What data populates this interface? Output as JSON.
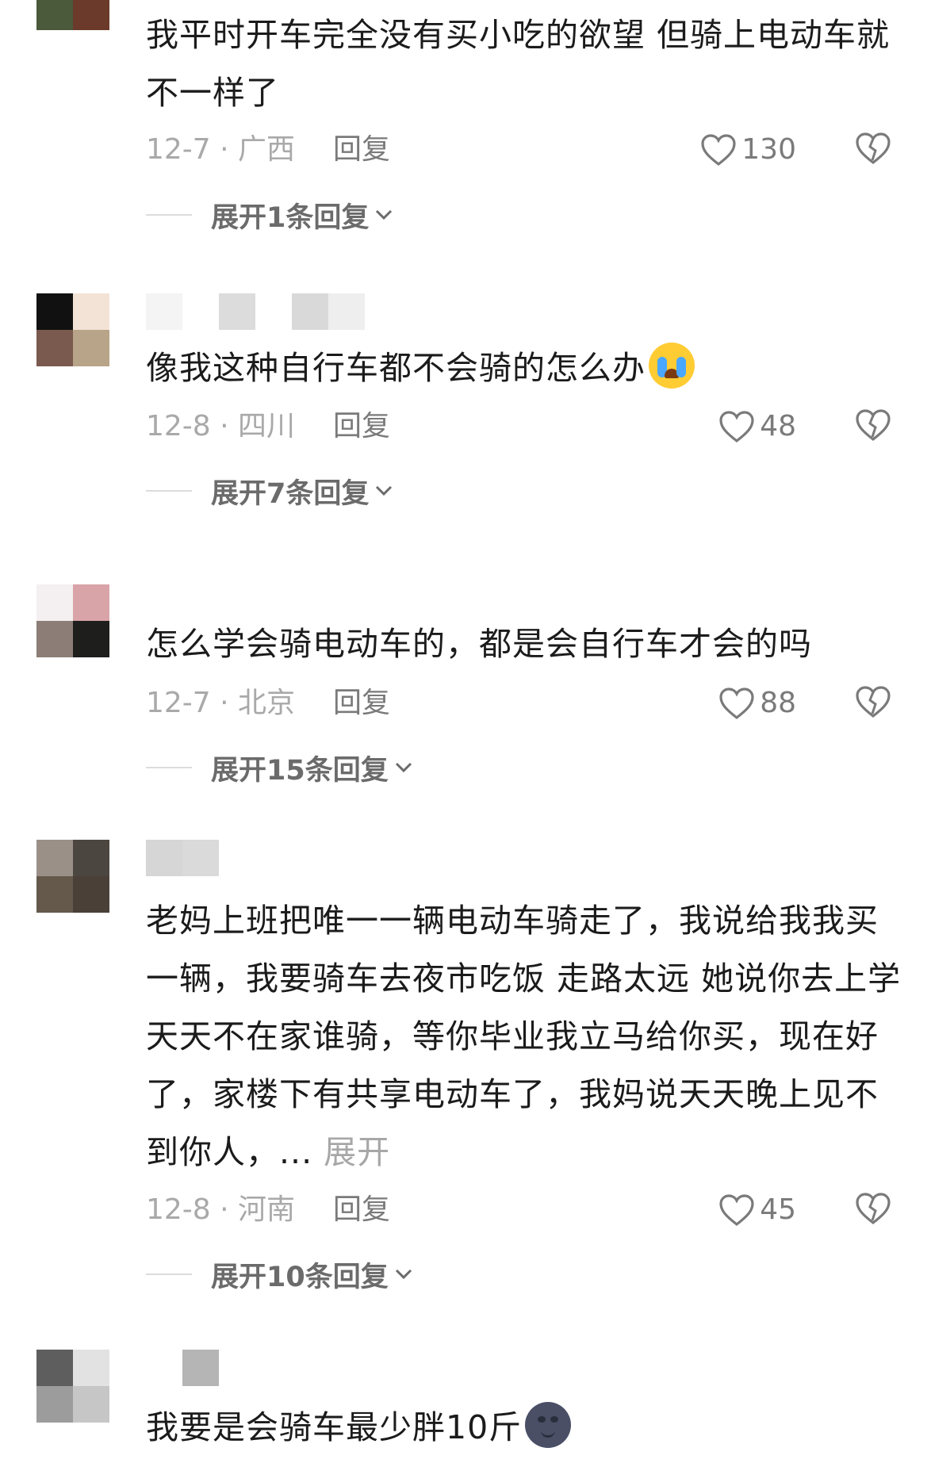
{
  "comments": [
    {
      "text": "我平时开车完全没有买小吃的欲望 但骑上电动车就不一样了",
      "date_location": "12-7 · 广西",
      "reply_label": "回复",
      "likes": "130",
      "expand_label": "展开1条回复",
      "avatar_colors": [
        "#4a5a3a",
        "#6b3a2a",
        "#ffffff",
        "#ffffff"
      ]
    },
    {
      "text": "像我这种自行车都不会骑的怎么办",
      "emoji": "loudly-crying-face-emoji",
      "date_location": "12-8 · 四川",
      "reply_label": "回复",
      "likes": "48",
      "expand_label": "展开7条回复",
      "avatar_colors": [
        "#111111",
        "#f3e3d6",
        "#7a5a4e",
        "#b8a488"
      ]
    },
    {
      "text": "怎么学会骑电动车的，都是会自行车才会的吗",
      "date_location": "12-7 · 北京",
      "reply_label": "回复",
      "likes": "88",
      "expand_label": "展开15条回复",
      "avatar_colors": [
        "#f4eff0",
        "#d9a4a8",
        "#8c7e76",
        "#1e1e1c"
      ]
    },
    {
      "text": "老妈上班把唯一一辆电动车骑走了，我说给我我买一辆，我要骑车去夜市吃饭 走路太远 她说你去上学天天不在家谁骑，等你毕业我立马给你买，现在好了，家楼下有共享电动车了，我妈说天天晚上见不到你人，...",
      "more_label": "展开",
      "date_location": "12-8 · 河南",
      "reply_label": "回复",
      "likes": "45",
      "expand_label": "展开10条回复",
      "avatar_colors": [
        "#9a9088",
        "#4c4640",
        "#65594c",
        "#4a4038"
      ]
    },
    {
      "text": "我要是会骑车最少胖10斤",
      "emoji": "new-moon-face-emoji",
      "avatar_colors": [
        "#5e5e5e",
        "#e2e2e2",
        "#9c9c9c",
        "#c6c6c6"
      ]
    }
  ]
}
